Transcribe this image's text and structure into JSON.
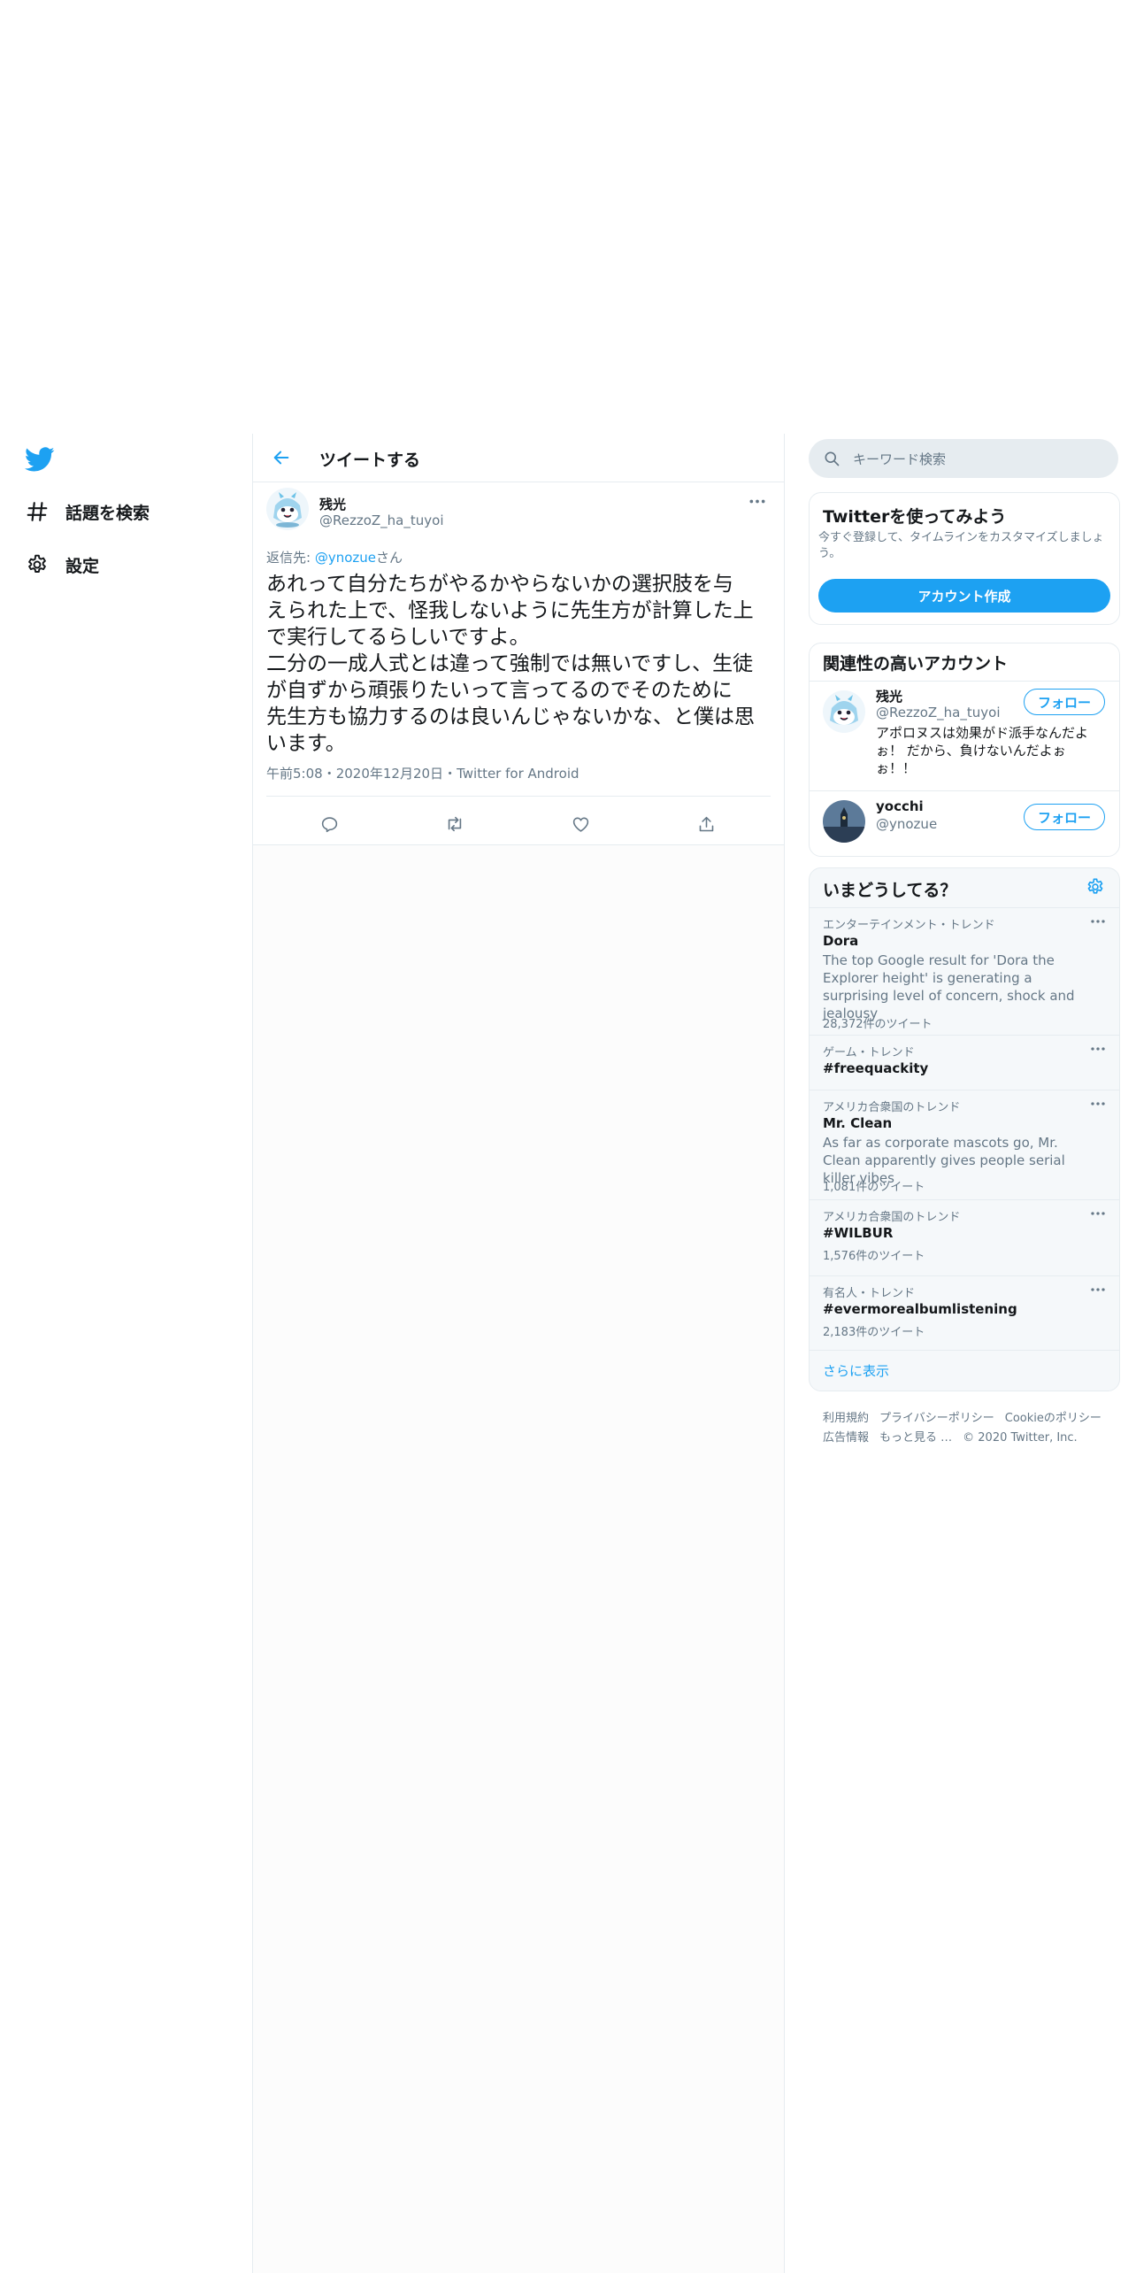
{
  "colors": {
    "accent": "#1da1f2",
    "text": "#14171a",
    "secondary": "#657786",
    "border": "#e6ecf0"
  },
  "nav": {
    "logo_icon": "twitter-bird-icon",
    "items": [
      {
        "icon": "hashtag-icon",
        "label": "話題を検索"
      },
      {
        "icon": "gear-icon",
        "label": "設定"
      }
    ]
  },
  "header": {
    "back_icon": "arrow-left-icon",
    "title": "ツイートする"
  },
  "tweet": {
    "name": "残光",
    "handle": "@RezzoZ_ha_tuyoi",
    "reply_prefix": "返信先: ",
    "reply_mention": "@ynozue",
    "reply_suffix": "さん",
    "body_lines": [
      "あれって自分たちがやるかやらないかの選択肢を与",
      "えられた上で、怪我しないように先生方が計算した上",
      "で実行してるらしいですよ。",
      "二分の一成人式とは違って強制では無いですし、生徒",
      "が自ずから頑張りたいって言ってるのでそのために",
      "先生方も協力するのは良いんじゃないかな、と僕は思",
      "います。"
    ],
    "time": "午前5:08",
    "date": "2020年12月20日",
    "source": "Twitter for Android",
    "sep": "・",
    "actions": [
      "reply-icon",
      "retweet-icon",
      "like-icon",
      "share-icon"
    ]
  },
  "search": {
    "placeholder": "キーワード検索"
  },
  "signup": {
    "title": "Twitterを使ってみよう",
    "subtitle": "今すぐ登録して、タイムラインをカスタマイズしましょう。",
    "button": "アカウント作成"
  },
  "related": {
    "title": "関連性の高いアカウント",
    "accounts": [
      {
        "name": "残光",
        "handle": "@RezzoZ_ha_tuyoi",
        "bio": "アポロヌスは効果がド派手なんだよぉ！ だから、負けないんだよぉぉ！！",
        "button": "フォロー"
      },
      {
        "name": "yocchi",
        "handle": "@ynozue",
        "bio": "",
        "button": "フォロー"
      }
    ]
  },
  "trends": {
    "title": "いまどうしてる？",
    "items": [
      {
        "context": "エンターテインメント・トレンド",
        "title": "Dora",
        "desc": "The top Google result for 'Dora the Explorer height' is generating a surprising level of concern, shock and jealousy",
        "count": "28,372件のツイート"
      },
      {
        "context": "ゲーム・トレンド",
        "title": "#freequackity",
        "desc": "",
        "count": ""
      },
      {
        "context": "アメリカ合衆国のトレンド",
        "title": "Mr. Clean",
        "desc": "As far as corporate mascots go, Mr. Clean apparently gives people serial killer vibes",
        "count": "1,081件のツイート"
      },
      {
        "context": "アメリカ合衆国のトレンド",
        "title": "#WILBUR",
        "desc": "",
        "count": "1,576件のツイート"
      },
      {
        "context": "有名人・トレンド",
        "title": "#evermorealbumlistening",
        "desc": "",
        "count": "2,183件のツイート"
      }
    ],
    "show_more": "さらに表示"
  },
  "footer": {
    "links": [
      "利用規約",
      "プライバシーポリシー",
      "Cookieのポリシー",
      "広告情報",
      "もっと見る …"
    ],
    "copyright": "© 2020 Twitter, Inc."
  }
}
